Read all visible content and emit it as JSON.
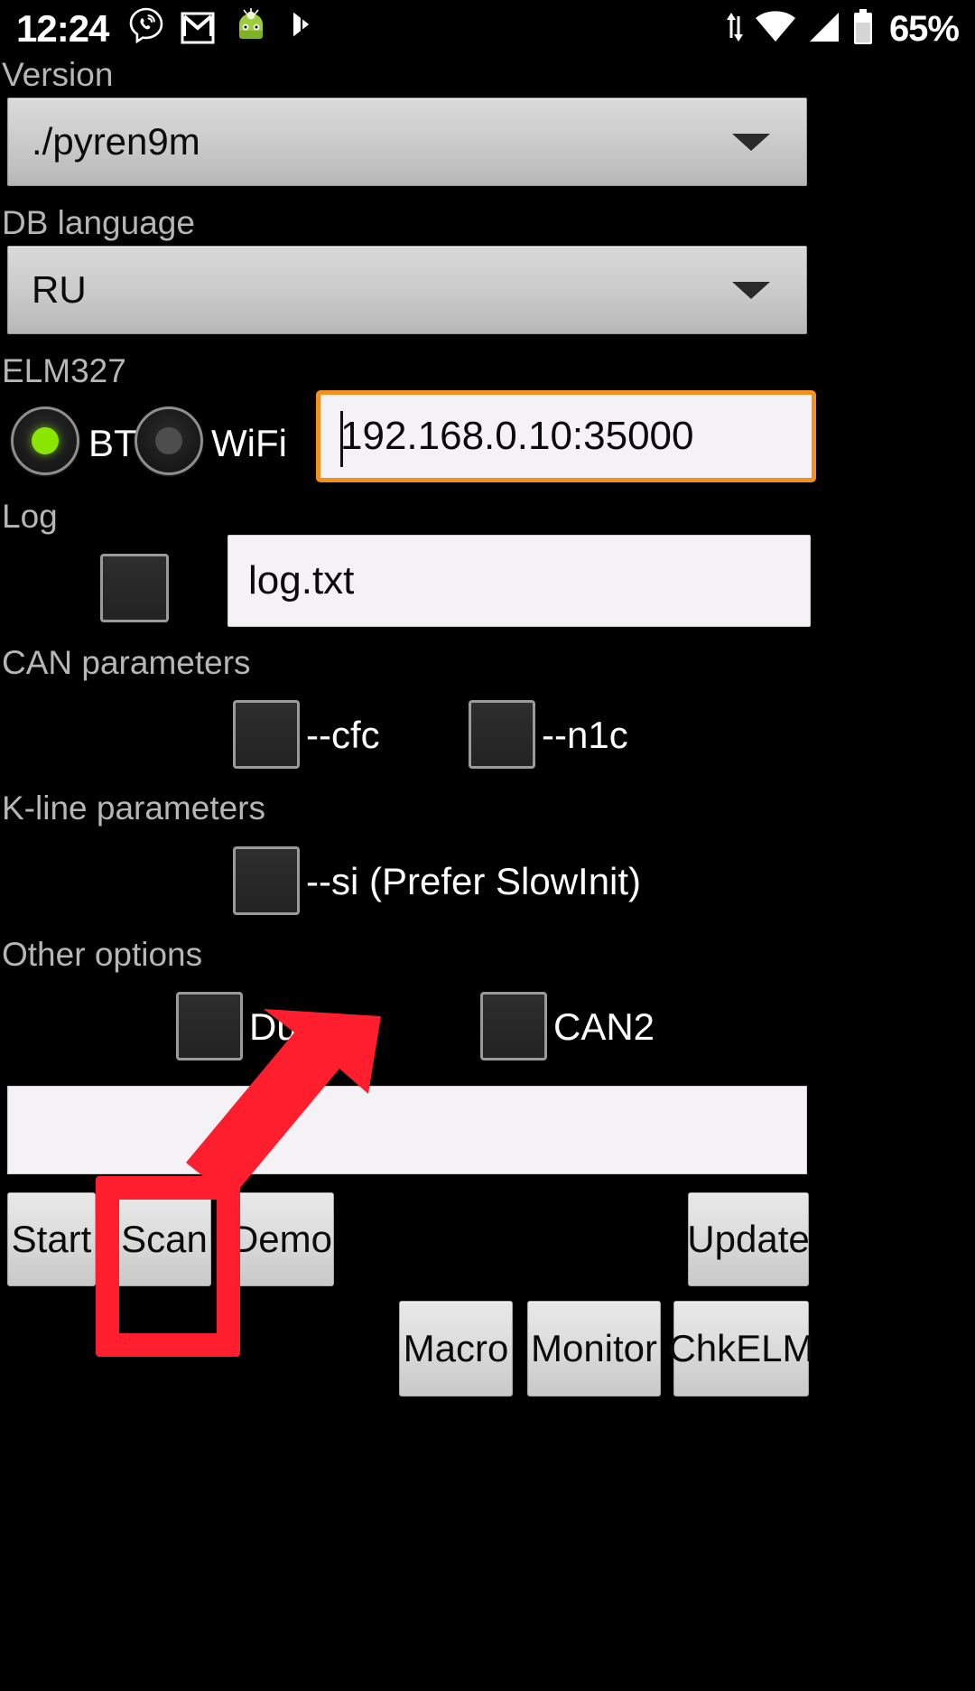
{
  "statusbar": {
    "clock": "12:24",
    "battery_percent": "65%",
    "icons": [
      "viber-icon",
      "gmail-icon",
      "android-app-icon",
      "bluetooth-share-icon",
      "sync-icon",
      "wifi-icon",
      "cell-signal-icon",
      "battery-icon"
    ]
  },
  "version": {
    "label": "Version",
    "value": "./pyren9m"
  },
  "db_language": {
    "label": "DB language",
    "value": "RU"
  },
  "elm327": {
    "label": "ELM327",
    "bt_label": "BT",
    "wifi_label": "WiFi",
    "selected": "BT",
    "address_value": "192.168.0.10:35000"
  },
  "log": {
    "label": "Log",
    "checked": false,
    "filename": "log.txt"
  },
  "can_parameters": {
    "label": "CAN parameters",
    "options": [
      {
        "label": "--cfc",
        "checked": false
      },
      {
        "label": "--n1c",
        "checked": false
      }
    ]
  },
  "kline_parameters": {
    "label": "K-line parameters",
    "options": [
      {
        "label": "--si (Prefer SlowInit)",
        "checked": false
      }
    ]
  },
  "other_options": {
    "label": "Other options",
    "options": [
      {
        "label": "Dump",
        "checked": false
      },
      {
        "label": "CAN2",
        "checked": false
      }
    ]
  },
  "status_field": {
    "value": ""
  },
  "buttons": {
    "start": "Start",
    "scan": "Scan",
    "demo": "Demo",
    "update": "Update",
    "macro": "Macro",
    "monitor": "Monitor",
    "chkelm": "ChkELM"
  },
  "annotation": {
    "color": "#ff1e2d",
    "target": "Scan"
  }
}
